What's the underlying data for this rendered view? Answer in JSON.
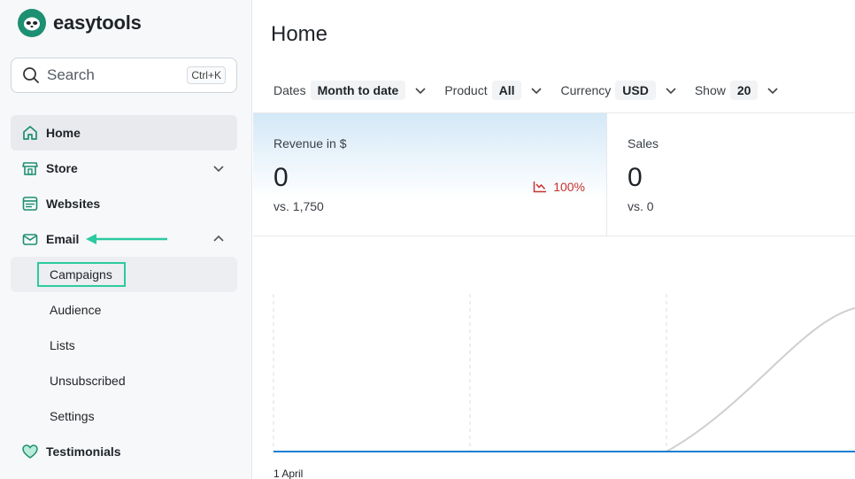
{
  "brand": {
    "name": "easytools",
    "logo_icon": "sloth-logo-icon",
    "accent": "#1d8f72"
  },
  "search": {
    "placeholder": "Search",
    "shortcut": "Ctrl+K"
  },
  "nav": {
    "items": [
      {
        "label": "Home",
        "icon": "home-icon",
        "active": true
      },
      {
        "label": "Store",
        "icon": "store-icon",
        "expandable": true
      },
      {
        "label": "Websites",
        "icon": "websites-icon"
      },
      {
        "label": "Email",
        "icon": "email-icon",
        "expanded": true
      }
    ],
    "email_sub": [
      "Campaigns",
      "Audience",
      "Lists",
      "Unsubscribed",
      "Settings"
    ],
    "after": [
      {
        "label": "Testimonials",
        "icon": "heart-icon"
      }
    ]
  },
  "annotation": {
    "highlight_color": "#2ccaa0"
  },
  "page": {
    "title": "Home"
  },
  "filters": [
    {
      "label": "Dates",
      "value": "Month to date"
    },
    {
      "label": "Product",
      "value": "All"
    },
    {
      "label": "Currency",
      "value": "USD"
    },
    {
      "label": "Show",
      "value": "20"
    }
  ],
  "cards": {
    "revenue": {
      "title": "Revenue in $",
      "value": "0",
      "compare": "vs. 1,750",
      "delta": "100%",
      "delta_color": "#c8322f"
    },
    "sales": {
      "title": "Sales",
      "value": "0",
      "compare": "vs. 0"
    }
  },
  "chart": {
    "x_start_label": "1 April",
    "line_color": "#1b7fd1",
    "compare_line_color": "#cfcfcf"
  }
}
